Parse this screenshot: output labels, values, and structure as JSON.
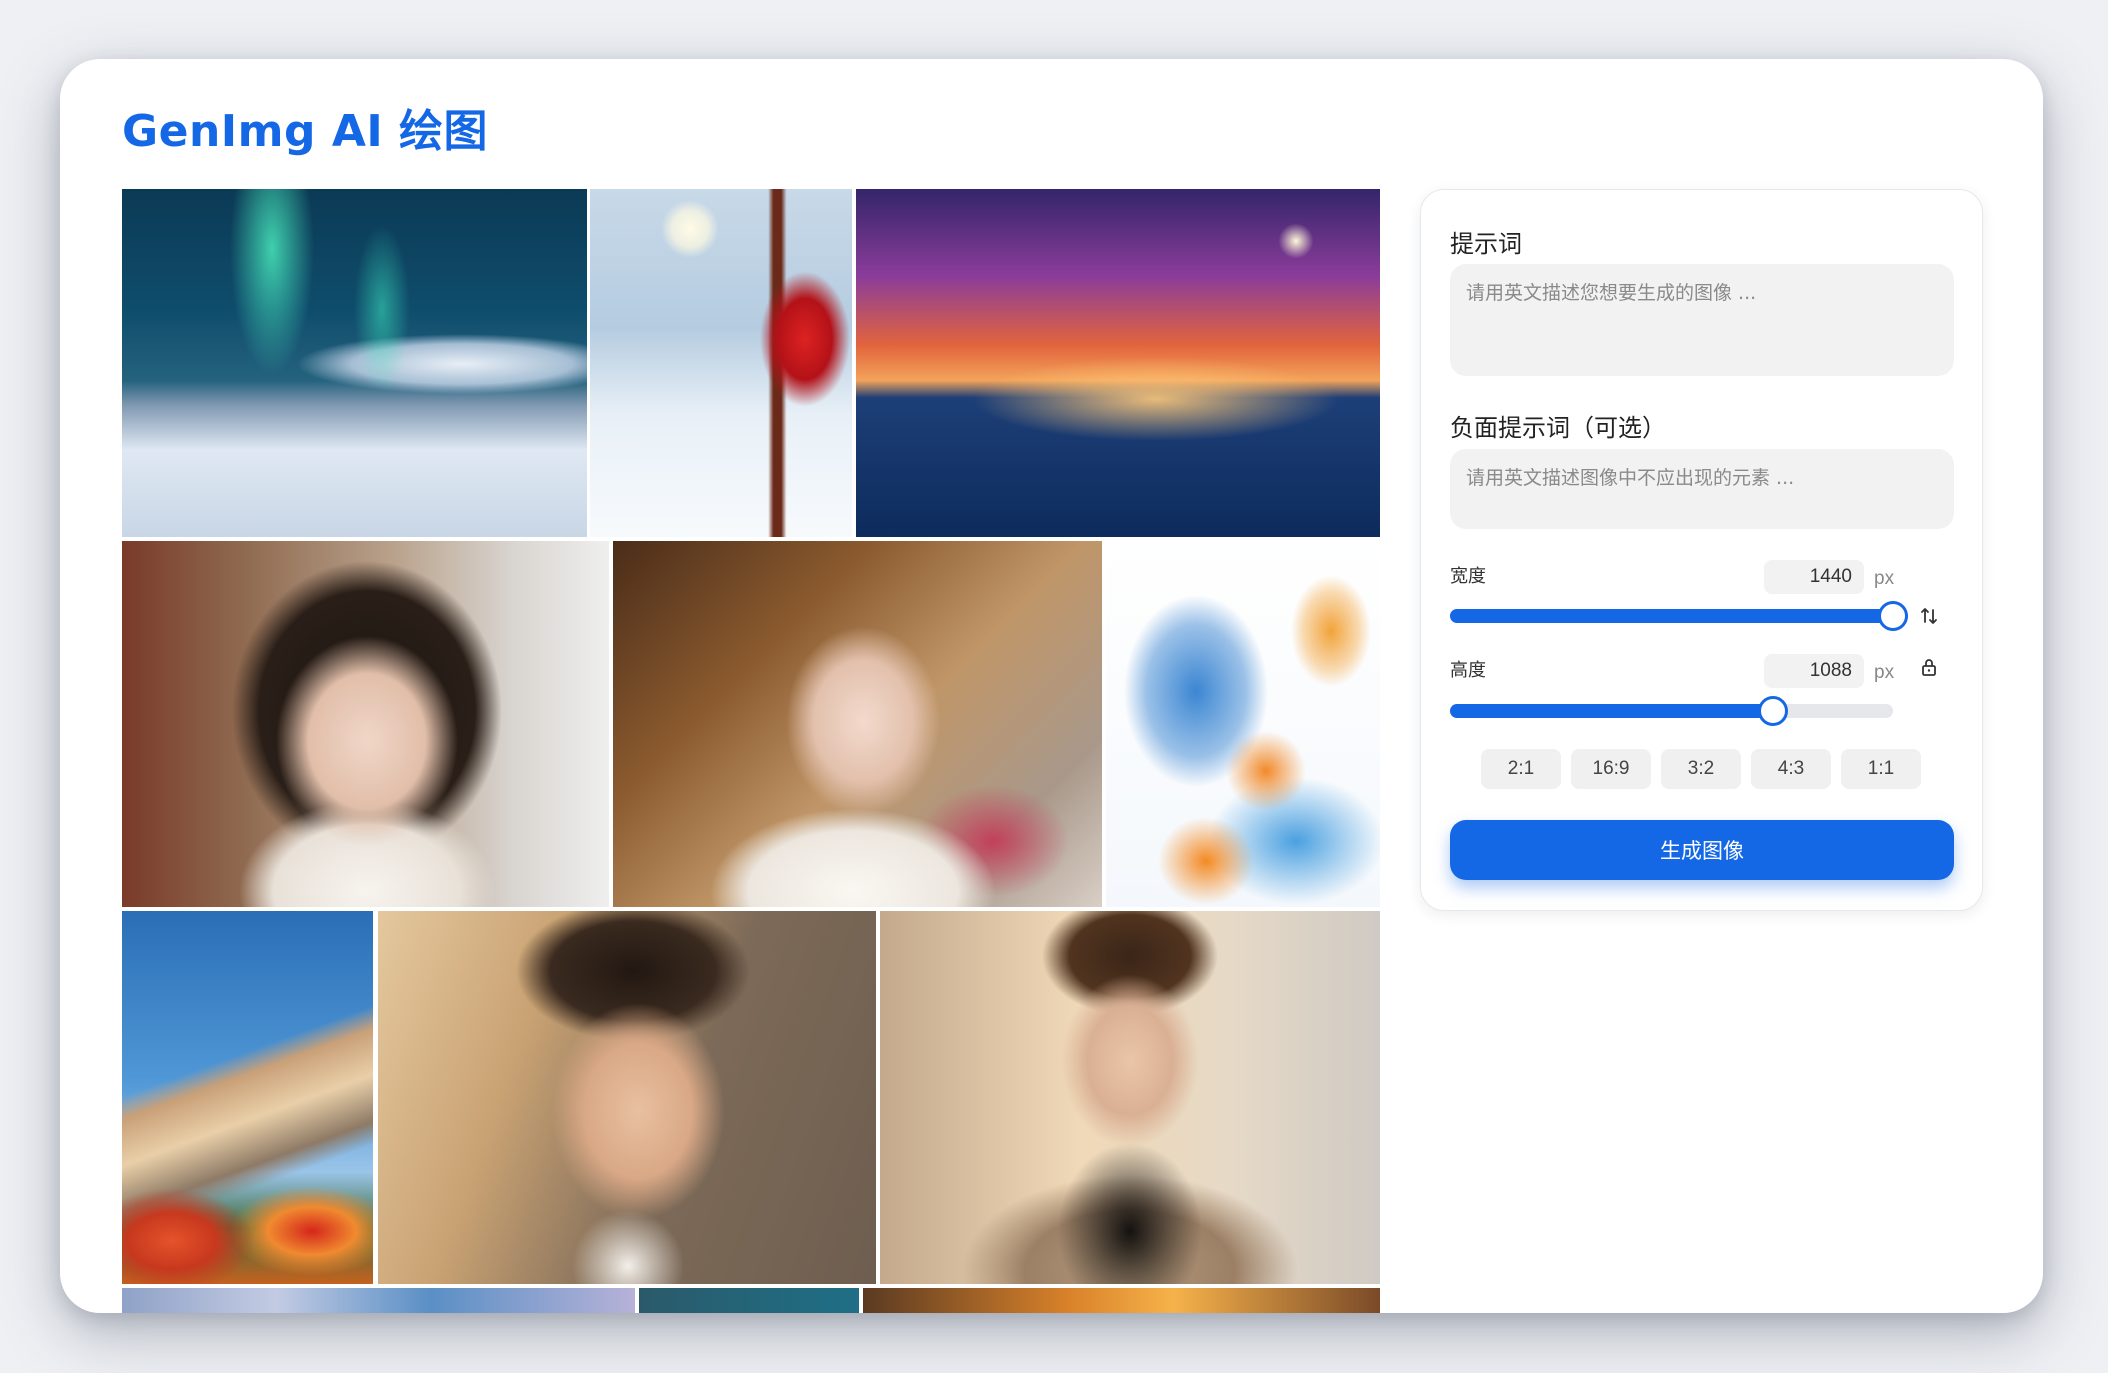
{
  "app": {
    "title": "GenImg AI 绘图"
  },
  "gallery": {
    "images": [
      {
        "subject": "aurora-cabin"
      },
      {
        "subject": "snow-foxes"
      },
      {
        "subject": "night-ship"
      },
      {
        "subject": "portrait-girl-cafe"
      },
      {
        "subject": "portrait-girl-restaurant"
      },
      {
        "subject": "watercolor-landscape"
      },
      {
        "subject": "autumn-mountain"
      },
      {
        "subject": "portrait-boy-closeup"
      },
      {
        "subject": "portrait-boy-hoodie"
      },
      {
        "subject": "sky-clouds"
      },
      {
        "subject": "teal-scene"
      },
      {
        "subject": "sunset-scene"
      }
    ]
  },
  "form": {
    "prompt_label": "提示词",
    "prompt_placeholder": "请用英文描述您想要生成的图像 ...",
    "negative_label": "负面提示词（可选）",
    "negative_placeholder": "请用英文描述图像中不应出现的元素 ...",
    "width_label": "宽度",
    "width_value": "1440",
    "height_label": "高度",
    "height_value": "1088",
    "unit": "px",
    "width_slider_fraction": 1.0,
    "height_slider_fraction": 0.73,
    "ratios": [
      "2:1",
      "16:9",
      "3:2",
      "4:3",
      "1:1"
    ],
    "generate_label": "生成图像",
    "swap_icon": "swap-icon",
    "lock_icon": "lock-icon"
  },
  "colors": {
    "accent": "#1468e6",
    "title": "#1468e6"
  }
}
